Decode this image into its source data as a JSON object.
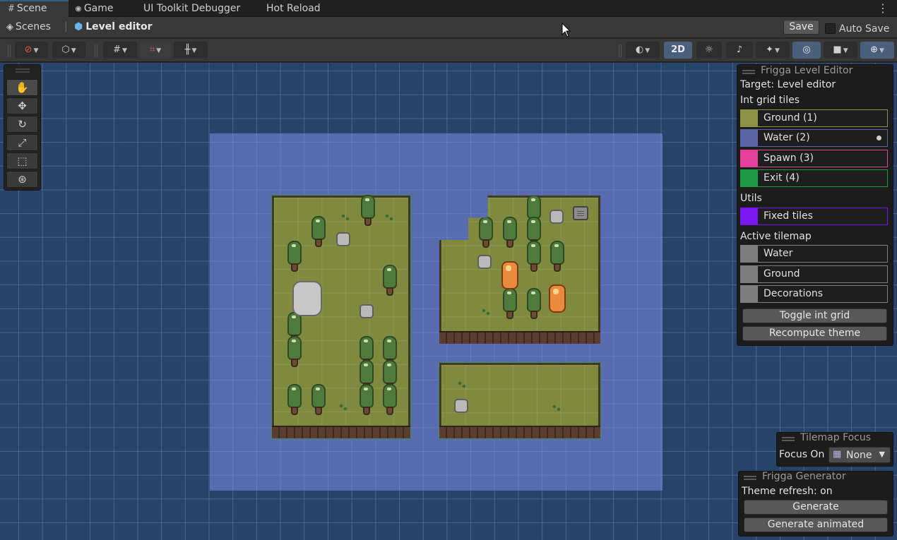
{
  "tabs": [
    {
      "icon": "#",
      "label": "Scene"
    },
    {
      "icon": "◉",
      "label": "Game"
    },
    {
      "icon": "",
      "label": "UI Toolkit Debugger"
    },
    {
      "icon": "",
      "label": "Hot Reload"
    }
  ],
  "breadcrumb": {
    "root": "Scenes",
    "current": "Level editor"
  },
  "header": {
    "save_label": "Save",
    "autosave_label": "Auto Save"
  },
  "toolbar": {
    "mode_2d": "2D"
  },
  "level_editor": {
    "title": "Frigga Level Editor",
    "target": "Target: Level editor",
    "int_grid_heading": "Int grid tiles",
    "int_grid": [
      {
        "label": "Ground (1)",
        "color": "#8c9243"
      },
      {
        "label": "Water (2)",
        "color": "#5a64a6"
      },
      {
        "label": "Spawn (3)",
        "color": "#e4409a"
      },
      {
        "label": "Exit (4)",
        "color": "#1e9a46"
      }
    ],
    "utils_heading": "Utils",
    "utils": [
      {
        "label": "Fixed tiles",
        "color": "#7a16f0"
      }
    ],
    "active_tilemap_heading": "Active tilemap",
    "tilemaps": [
      {
        "label": "Water",
        "color": "#7d7d7d"
      },
      {
        "label": "Ground",
        "color": "#7d7d7d"
      },
      {
        "label": "Decorations",
        "color": "#7d7d7d"
      }
    ],
    "toggle_label": "Toggle int grid",
    "recompute_label": "Recompute theme"
  },
  "tilemap_focus": {
    "title": "Tilemap Focus",
    "label": "Focus On",
    "value": "None"
  },
  "generator": {
    "title": "Frigga Generator",
    "status": "Theme refresh: on",
    "generate_label": "Generate",
    "generate_animated_label": "Generate animated"
  },
  "colors": {
    "accent": "#2c5d87",
    "scene_bg": "#27436a",
    "bounds": "#828ce6",
    "grass": "#7f8a3f"
  }
}
